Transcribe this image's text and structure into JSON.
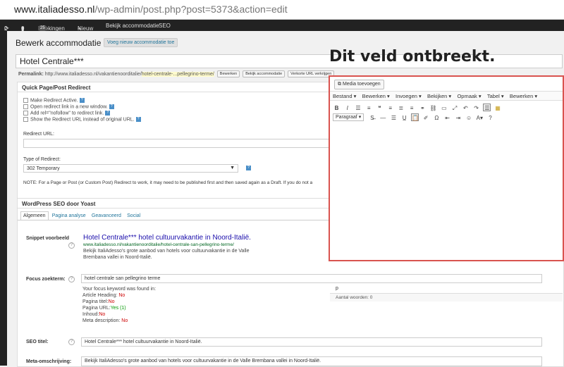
{
  "browser": {
    "url_host": "www.italiadesso.nl",
    "url_path": "/wp-admin/post.php?post=5373&action=edit"
  },
  "adminbar": {
    "updates_count": "2",
    "comments_count": "0",
    "bookings_label": "Boekingen",
    "bookings_badge": "25",
    "new_label": "Nieuw",
    "view_label": "Bekijk accommodatie",
    "seo_label": "SEO"
  },
  "page": {
    "title": "Bewerk accommodatie",
    "add_new": "Voeg nieuw accommodatie toe",
    "post_title": "Hotel Centrale***",
    "permalink_label": "Permalink:",
    "permalink_base": "http://www.italiadesso.nl/vakantienoorditalie/",
    "permalink_slug": "hotel-centrale-...pellegrino-terme/",
    "btn_edit": "Bewerken",
    "btn_view": "Bekijk accommodatie",
    "btn_short": "Verkorte URL verkrijgen"
  },
  "quickpage": {
    "title": "Quick Page/Post Redirect",
    "opt1": "Make Redirect Active.",
    "opt2": "Open redirect link in a new window.",
    "opt3": "Add rel=\"nofollow\" to redirect link.",
    "opt4": "Show the Redirect URL instead of original URL.",
    "redirect_url_label": "Redirect URL:",
    "redirect_url_value": "",
    "type_label": "Type of Redirect:",
    "type_value": "302 Temporary",
    "note": "NOTE: For a Page or Post (or Custom Post) Redirect to work, it may need to be published first and then saved again as a Draft. If you do not a"
  },
  "seo": {
    "title": "WordPress SEO door Yoast",
    "tabs": [
      "Algemeen",
      "Pagina analyse",
      "Geavanceerd",
      "Social"
    ],
    "snippet_label": "Snippet voorbeeld",
    "snippet_title": "Hotel Centrale*** hotel cultuurvakantie in Noord-Italië.",
    "snippet_url": "www.italiadesso.nl/vakantienoorditalie/hotel-centrale-san-pellegrino-terme/",
    "snippet_desc": "Bekijk ItaliAdesso's grote aanbod van hotels voor cultuurvakantie in de Valle Brembana vallei in Noord-Italië.",
    "focus_label": "Focus zoekterm:",
    "focus_value": "hotel centrale san pellegrino terme",
    "focus_found": "Your focus keyword was found in:",
    "fk_heading": "Article Heading:",
    "fk_heading_val": "No",
    "fk_title": "Pagina titel:",
    "fk_title_val": "No",
    "fk_url": "Pagina URL:",
    "fk_url_val": "Yes (1)",
    "fk_content": "Inhoud:",
    "fk_content_val": "No",
    "fk_meta": "Meta description:",
    "fk_meta_val": "No",
    "seo_title_label": "SEO titel:",
    "seo_title_value": "Hotel Centrale*** hotel cultuurvakantie in Noord-Italië.",
    "meta_label": "Meta-omschrijving:",
    "meta_value": "Bekijk ItaliAdesso's grote aanbod van hotels voor cultuurvakantie in de Valle Brembana vallei in Noord-Italië."
  },
  "editor": {
    "media_btn": "Media toevoegen",
    "menus": [
      "Bestand ▾",
      "Bewerken ▾",
      "Invoegen ▾",
      "Bekijken ▾",
      "Opmaak ▾",
      "Tabel ▾",
      "Bewerken ▾"
    ],
    "format_select": "Paragraaf",
    "path": "p",
    "wordcount": "Aantal woorden: 0"
  },
  "annotation": "Dit veld ontbreekt."
}
